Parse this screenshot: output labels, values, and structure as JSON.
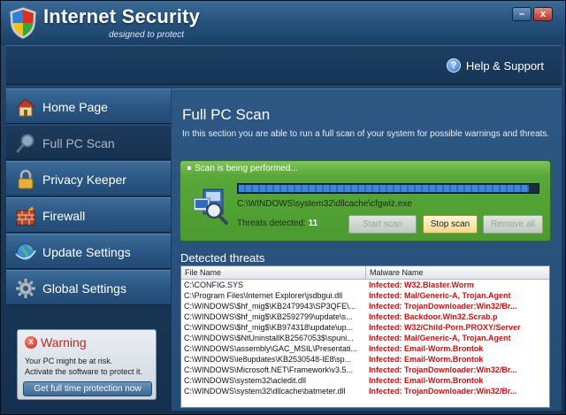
{
  "window": {
    "title": "Internet Security",
    "subtitle": "designed to protect",
    "minimize_label": "–",
    "close_label": "x"
  },
  "header": {
    "help_label": "Help & Support",
    "help_icon": "?"
  },
  "sidebar": {
    "items": [
      {
        "label": "Home Page",
        "icon": "house-icon"
      },
      {
        "label": "Full PC Scan",
        "icon": "magnifier-icon"
      },
      {
        "label": "Privacy Keeper",
        "icon": "padlock-icon"
      },
      {
        "label": "Firewall",
        "icon": "brick-wall-icon"
      },
      {
        "label": "Update Settings",
        "icon": "globe-icon"
      },
      {
        "label": "Global Settings",
        "icon": "gear-icon"
      }
    ]
  },
  "warning": {
    "title": "Warning",
    "line1": "Your PC might be at risk.",
    "line2": "Activate the software to protect it.",
    "button": "Get full time protection now"
  },
  "main": {
    "title": "Full PC Scan",
    "description": "In this section you are able to run a full scan of your system for possible warnings and threats."
  },
  "scan": {
    "status": "Scan is being performed...",
    "progress": 0.97,
    "current_file": "C:\\WINDOWS\\system32\\dllcache\\cfgwiz.exe",
    "threats_label": "Threats detected: ",
    "threats_count": "11",
    "start_label": "Start scan",
    "stop_label": "Stop scan",
    "remove_label": "Remove all"
  },
  "threats": {
    "title": "Detected threats",
    "col_file": "File Name",
    "col_malware": "Malware Name",
    "rows": [
      {
        "file": "C:\\CONFIG.SYS",
        "malware": "Infected: W32.Blaster.Worm"
      },
      {
        "file": "C:\\Program Files\\Internet Explorer\\jsdbgui.dll",
        "malware": "Infected: Mal/Generic-A, Trojan.Agent"
      },
      {
        "file": "C:\\WINDOWS\\$hf_mig$\\KB2479943\\SP3QFE\\...",
        "malware": "Infected: TrojanDownloader:Win32/Br..."
      },
      {
        "file": "C:\\WINDOWS\\$hf_mig$\\KB2592799\\update\\s...",
        "malware": "Infected: Backdoor.Win32.Scrab.p"
      },
      {
        "file": "C:\\WINDOWS\\$hf_mig$\\KB974318\\update\\up...",
        "malware": "Infected: W32/Child-Porn.PROXY/Server"
      },
      {
        "file": "C:\\WINDOWS\\$NtUninstallKB2567053$\\spuni...",
        "malware": "Infected: Mal/Generic-A, Trojan.Agent"
      },
      {
        "file": "C:\\WINDOWS\\assembly\\GAC_MSIL\\Presentati...",
        "malware": "Infected: Email-Worm.Brontok"
      },
      {
        "file": "C:\\WINDOWS\\ie8updates\\KB2530548-IE8\\sp...",
        "malware": "Infected: Email-Worm.Brontok"
      },
      {
        "file": "C:\\WINDOWS\\Microsoft.NET\\Framework\\v3.5...",
        "malware": "Infected: TrojanDownloader:Win32/Br..."
      },
      {
        "file": "C:\\WINDOWS\\system32\\acledit.dll",
        "malware": "Infected: Email-Worm.Brontok"
      },
      {
        "file": "C:\\WINDOWS\\system32\\dllcache\\batmeter.dll",
        "malware": "Infected: TrojanDownloader:Win32/Br..."
      }
    ]
  },
  "colors": {
    "infected": "#d40e0e",
    "scan_panel": "#5aa83a",
    "warning_title": "#c0281c"
  }
}
